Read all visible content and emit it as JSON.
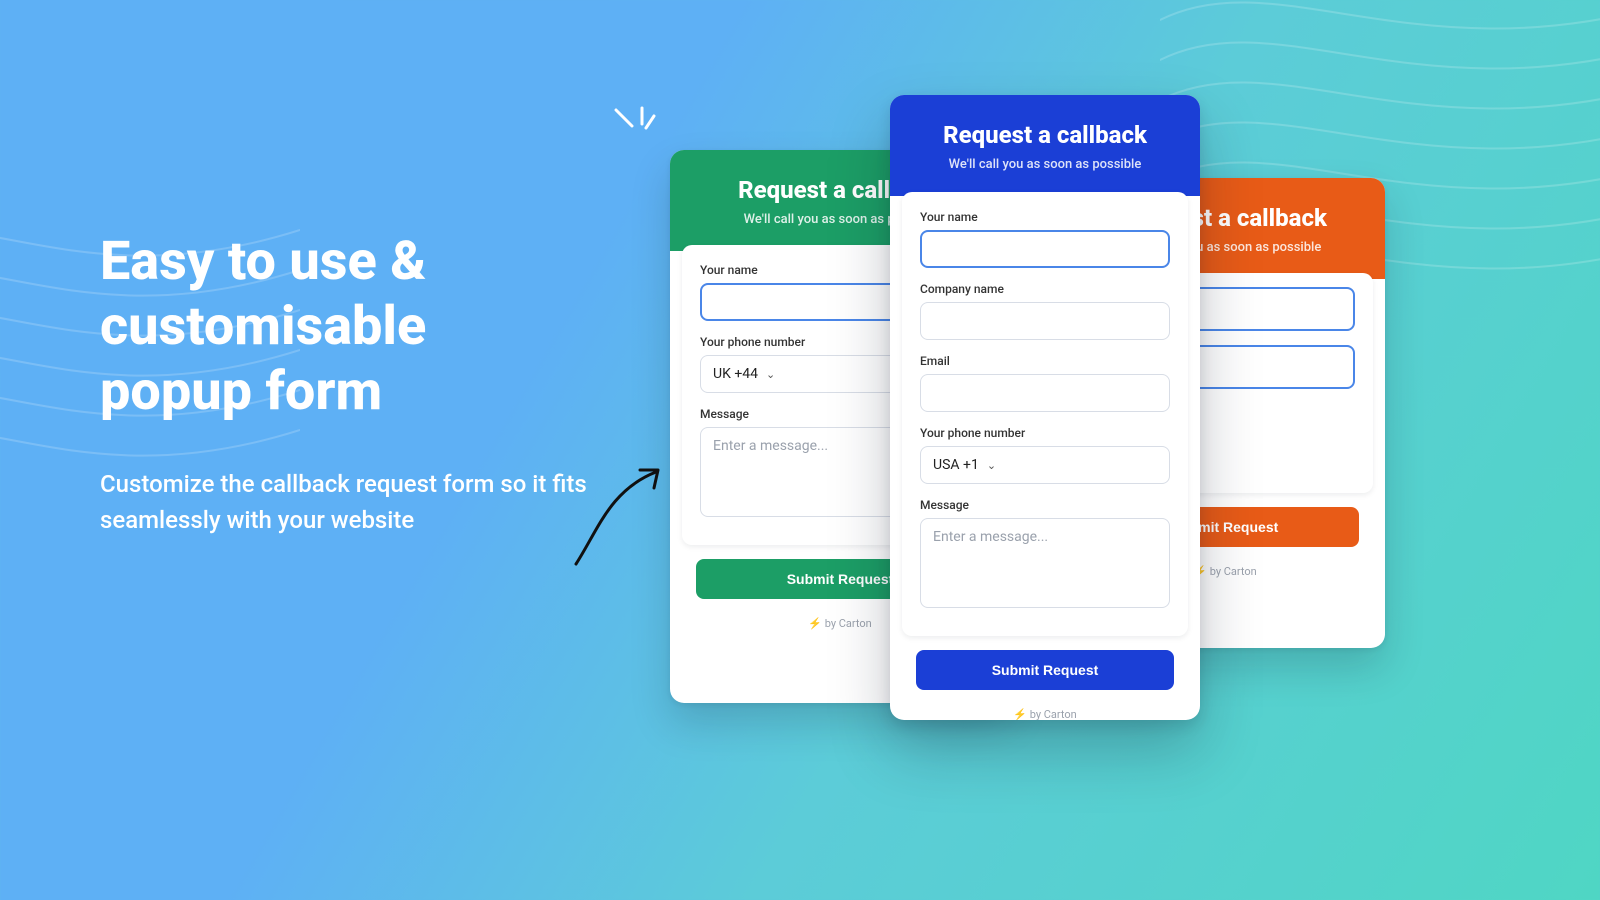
{
  "hero": {
    "headline_l1": "Easy to use &",
    "headline_l2": "customisable",
    "headline_l3": "popup form",
    "subcopy": "Customize the callback request form so it fits seamlessly with your website"
  },
  "popups": {
    "title": "Request a callback",
    "subtitle": "We'll call you as soon as possible",
    "labels": {
      "name": "Your name",
      "company": "Company name",
      "email": "Email",
      "phone": "Your phone number",
      "message": "Message"
    },
    "placeholders": {
      "message": "Enter a message..."
    },
    "phone_options": {
      "green": "UK +44",
      "blue": "USA +1"
    },
    "submit_label": "Submit Request",
    "byline": "by Carton"
  }
}
